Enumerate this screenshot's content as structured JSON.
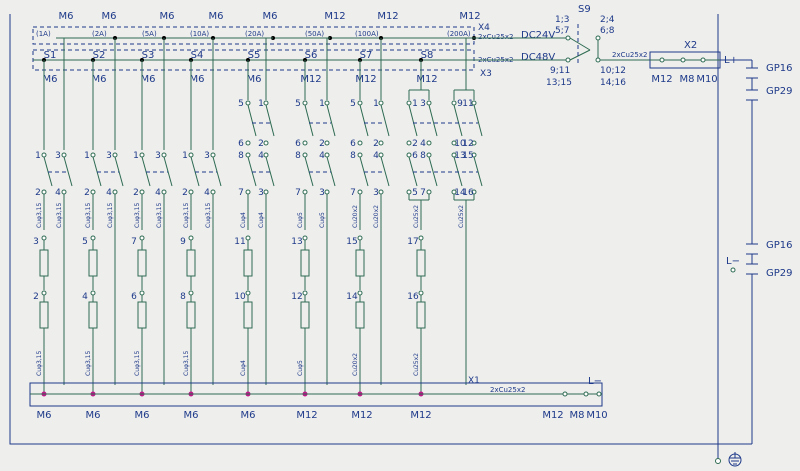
{
  "top_labels": [
    "M6",
    "M6",
    "M6",
    "M6",
    "M6",
    "M12",
    "M12",
    "M12"
  ],
  "ratings": [
    "(1A)",
    "(2A)",
    "(5A)",
    "(10A)",
    "(20A)",
    "(50A)",
    "(100A)",
    "(200A)"
  ],
  "bus_top": {
    "tag": "X4",
    "cable": "2xCu25x2"
  },
  "bus_mid": {
    "tag": "X3",
    "cable": "2xCu25x2"
  },
  "bus_bottom": {
    "tag": "X1",
    "cable": "2xCu25x2"
  },
  "switches": [
    {
      "id": "S1",
      "label_under": "M6",
      "cable": "Cuφ3,15",
      "t_top": [
        "1",
        "3"
      ],
      "t_mid": [
        "2",
        "4"
      ],
      "r1": "3",
      "r2": "2"
    },
    {
      "id": "S2",
      "label_under": "M6",
      "cable": "Cuφ3,15",
      "t_top": [
        "1",
        "3"
      ],
      "t_mid": [
        "2",
        "4"
      ],
      "r1": "5",
      "r2": "4"
    },
    {
      "id": "S3",
      "label_under": "M6",
      "cable": "Cuφ3,15",
      "t_top": [
        "1",
        "3"
      ],
      "t_mid": [
        "2",
        "4"
      ],
      "r1": "7",
      "r2": "6"
    },
    {
      "id": "S4",
      "label_under": "M6",
      "cable": "Cuφ3,15",
      "t_top": [
        "1",
        "3"
      ],
      "t_mid": [
        "2",
        "4"
      ],
      "r1": "9",
      "r2": "8"
    },
    {
      "id": "S5",
      "label_under": "M6",
      "cable": "Cuφ4",
      "t_pre": [
        "5",
        "1"
      ],
      "t_top": [
        "6",
        "2"
      ],
      "t_top2": [
        "8",
        "4"
      ],
      "t_mid": [
        "7",
        "3"
      ],
      "r1": "11",
      "r2": "10"
    },
    {
      "id": "S6",
      "label_under": "M12",
      "cable": "Cuφ5",
      "t_pre": [
        "5",
        "1"
      ],
      "t_top": [
        "6",
        "2"
      ],
      "t_top2": [
        "8",
        "4"
      ],
      "t_mid": [
        "7",
        "3"
      ],
      "r1": "13",
      "r2": "12"
    },
    {
      "id": "S7",
      "label_under": "M12",
      "cable": "Cu20x2",
      "t_pre": [
        "5",
        "1"
      ],
      "t_top": [
        "6",
        "2"
      ],
      "t_top2": [
        "8",
        "4"
      ],
      "t_mid": [
        "7",
        "3"
      ],
      "r1": "15",
      "r2": "14"
    },
    {
      "id": "S8",
      "label_under": "M12",
      "cable": "Cu25x2",
      "t_pre": [
        "1",
        "3",
        "9",
        "11"
      ],
      "t_top": [
        "2",
        "4",
        "10",
        "12"
      ],
      "t_top2": [
        "6",
        "8",
        "13",
        "15"
      ],
      "t_mid": [
        "5",
        "7",
        "14",
        "16"
      ],
      "r1": "17",
      "r2": "16"
    }
  ],
  "bottom_labels": [
    "M6",
    "M6",
    "M6",
    "M6",
    "M6",
    "M12",
    "M12",
    "M12"
  ],
  "bottom_right_labels": [
    "M12",
    "M8",
    "M10"
  ],
  "s9": {
    "id": "S9",
    "dc24": "DC24V",
    "dc48": "DC48V",
    "t_a1": "1;3",
    "t_a2": "5;7",
    "t_b1": "2;4",
    "t_b2": "6;8",
    "t_c1": "9;11",
    "t_c2": "13;15",
    "t_d1": "10;12",
    "t_d2": "14;16",
    "cable": "2xCu25x2"
  },
  "x2": {
    "tag": "X2",
    "terminals": [
      "M12",
      "M8",
      "M10"
    ],
    "plus": "L+"
  },
  "gp": [
    "GP16",
    "GP29",
    "GP16",
    "GP29"
  ],
  "lminus": [
    "L−",
    "L−"
  ],
  "colors": {
    "wire": "#2e6b52",
    "box": "#1e3a8a",
    "node": "#c0178a",
    "background": "#eeeeec"
  }
}
